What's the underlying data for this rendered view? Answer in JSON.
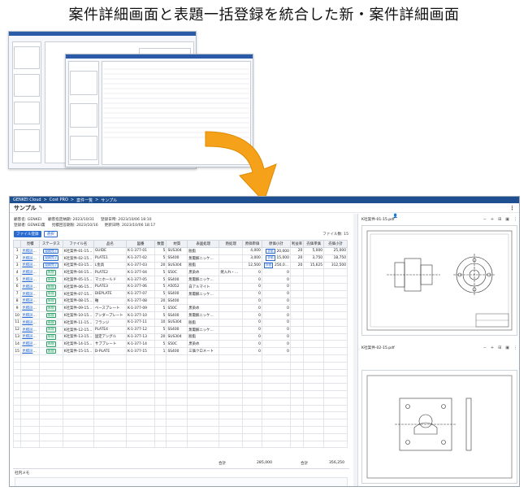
{
  "headline": "案件詳細画面と表題一括登録を統合した新・案件詳細画面",
  "app": {
    "breadcrumb": [
      "GENKEI Cloud",
      ">",
      "Cost PRO",
      ">",
      "案件一覧",
      ">",
      "サンプル"
    ],
    "top_right": [
      "登録",
      "一覧",
      "⚙",
      "▾",
      "👤"
    ],
    "page_title": "サンプル",
    "page_title_icon": "pencil-icon",
    "meta": {
      "client_label": "顧客名: GENKEI",
      "client_deadline": "顧客指定納期: 2023/10/31",
      "registered_at": "登録日時: 2023/10/06 18:10",
      "registrant": "登録者: GENKEI薫",
      "reply_deadline": "見積回答期限: 2023/10/16",
      "updated_at": "更新日時: 2023/10/06 18:17"
    },
    "buttons": {
      "file_register": "ファイル登録",
      "select": "選択"
    },
    "file_count": "ファイル数: 15",
    "columns": [
      "",
      "見積",
      "ステータス",
      "ファイル名",
      "品名",
      "図番",
      "数量",
      "材質",
      "表面処理",
      "熱処理",
      "原価単価",
      "原価小計",
      "利益率",
      "売価単価",
      "売価小計"
    ],
    "rows": [
      {
        "no": "1",
        "link": "見積詳細へ",
        "status": "見積完了",
        "status_type": "done",
        "file": "K社案件-01-15...",
        "name": "GUIDE",
        "drawing": "K-1-377-01",
        "qty": "5",
        "material": "SUS304",
        "surface": "脱脂",
        "heat": "",
        "cost_unit": "4,000",
        "cost_total": "20,000",
        "margin": "20",
        "price_unit": "5,000",
        "price_total": "25,000"
      },
      {
        "no": "2",
        "link": "見積詳細へ",
        "status": "見積完了",
        "status_type": "done",
        "file": "K社案件-02-15...",
        "name": "PLATE1",
        "drawing": "K-1-377-02",
        "qty": "5",
        "material": "SS400",
        "surface": "無電解ニッケ...",
        "heat": "",
        "cost_unit": "3,000",
        "cost_total": "15,000",
        "margin": "20",
        "price_unit": "3,750",
        "price_total": "18,750"
      },
      {
        "no": "3",
        "link": "見積詳細へ",
        "status": "見積完了",
        "status_type": "done",
        "file": "K社案件-03-15...",
        "name": "L金具",
        "drawing": "K-1-377-03",
        "qty": "20",
        "material": "SUS304",
        "surface": "脱脂",
        "heat": "",
        "cost_unit": "12,500",
        "cost_total": "250,000",
        "margin": "20",
        "price_unit": "15,625",
        "price_total": "312,500"
      },
      {
        "no": "4",
        "link": "見積詳細へ",
        "status": "新規",
        "status_type": "new",
        "file": "K社案件-04-15...",
        "name": "PLATE2",
        "drawing": "K-1-377-04",
        "qty": "5",
        "material": "S50C",
        "surface": "黒染め",
        "heat": "焼入れ・焼戻し",
        "cost_unit": "0",
        "cost_total": "0",
        "margin": "",
        "price_unit": "",
        "price_total": ""
      },
      {
        "no": "5",
        "link": "見積詳細へ",
        "status": "新規",
        "status_type": "new",
        "file": "K社案件-05-15...",
        "name": "マニホールド",
        "drawing": "K-1-377-05",
        "qty": "5",
        "material": "SS400",
        "surface": "無電解ニッケ...",
        "heat": "",
        "cost_unit": "0",
        "cost_total": "0",
        "margin": "",
        "price_unit": "",
        "price_total": ""
      },
      {
        "no": "6",
        "link": "見積詳細へ",
        "status": "新規",
        "status_type": "new",
        "file": "K社案件-06-15...",
        "name": "PLATE3",
        "drawing": "K-1-377-06",
        "qty": "5",
        "material": "A5052",
        "surface": "白アルマイト",
        "heat": "",
        "cost_unit": "0",
        "cost_total": "0",
        "margin": "",
        "price_unit": "",
        "price_total": ""
      },
      {
        "no": "7",
        "link": "見積詳細へ",
        "status": "新規",
        "status_type": "new",
        "file": "K社案件-07-15...",
        "name": "DIEPLATE",
        "drawing": "K-1-377-07",
        "qty": "5",
        "material": "SS400",
        "surface": "無電解ニッケ...",
        "heat": "",
        "cost_unit": "0",
        "cost_total": "0",
        "margin": "",
        "price_unit": "",
        "price_total": ""
      },
      {
        "no": "8",
        "link": "見積詳細へ",
        "status": "新規",
        "status_type": "new",
        "file": "K社案件-08-15...",
        "name": "軸",
        "drawing": "K-1-377-08",
        "qty": "20",
        "material": "SS400",
        "surface": "",
        "heat": "",
        "cost_unit": "0",
        "cost_total": "0",
        "margin": "",
        "price_unit": "",
        "price_total": ""
      },
      {
        "no": "9",
        "link": "見積詳細へ",
        "status": "新規",
        "status_type": "new",
        "file": "K社案件-09-15...",
        "name": "ベースプレート",
        "drawing": "K-1-377-09",
        "qty": "5",
        "material": "S50C",
        "surface": "黒染め",
        "heat": "",
        "cost_unit": "0",
        "cost_total": "0",
        "margin": "",
        "price_unit": "",
        "price_total": ""
      },
      {
        "no": "10",
        "link": "見積詳細へ",
        "status": "新規",
        "status_type": "new",
        "file": "K社案件-10-15...",
        "name": "アンダープレート",
        "drawing": "K-1-377-10",
        "qty": "5",
        "material": "SS400",
        "surface": "無電解ニッケ...",
        "heat": "",
        "cost_unit": "0",
        "cost_total": "0",
        "margin": "",
        "price_unit": "",
        "price_total": ""
      },
      {
        "no": "11",
        "link": "見積詳細へ",
        "status": "新規",
        "status_type": "new",
        "file": "K社案件-11-15...",
        "name": "フランジ",
        "drawing": "K-1-377-11",
        "qty": "10",
        "material": "SUS304",
        "surface": "脱脂",
        "heat": "",
        "cost_unit": "0",
        "cost_total": "0",
        "margin": "",
        "price_unit": "",
        "price_total": ""
      },
      {
        "no": "12",
        "link": "見積詳細へ",
        "status": "新規",
        "status_type": "new",
        "file": "K社案件-12-15...",
        "name": "PLATE4",
        "drawing": "K-1-377-12",
        "qty": "5",
        "material": "SS400",
        "surface": "無電解ニッケ...",
        "heat": "",
        "cost_unit": "0",
        "cost_total": "0",
        "margin": "",
        "price_unit": "",
        "price_total": ""
      },
      {
        "no": "13",
        "link": "見積詳細へ",
        "status": "新規",
        "status_type": "new",
        "file": "K社案件-13-15...",
        "name": "固定アングル",
        "drawing": "K-1-377-13",
        "qty": "20",
        "material": "SUS304",
        "surface": "脱脂",
        "heat": "",
        "cost_unit": "0",
        "cost_total": "0",
        "margin": "",
        "price_unit": "",
        "price_total": ""
      },
      {
        "no": "14",
        "link": "見積詳細へ",
        "status": "新規",
        "status_type": "new",
        "file": "K社案件-14-15...",
        "name": "サブプレート",
        "drawing": "K-1-377-14",
        "qty": "5",
        "material": "S50C",
        "surface": "黒染め",
        "heat": "",
        "cost_unit": "0",
        "cost_total": "0",
        "margin": "",
        "price_unit": "",
        "price_total": ""
      },
      {
        "no": "15",
        "link": "見積詳細へ",
        "status": "新規",
        "status_type": "new",
        "file": "K社案件-15-15...",
        "name": "D-PLATE",
        "drawing": "K-1-377-15",
        "qty": "1",
        "material": "SS400",
        "surface": "三価クロメート",
        "heat": "",
        "cost_unit": "0",
        "cost_total": "0",
        "margin": "",
        "price_unit": "",
        "price_total": ""
      }
    ],
    "ext_label": "評価",
    "totals": {
      "label1": "合計",
      "value1": "285,000",
      "label2": "合計",
      "value2": "356,250"
    },
    "memo_label": "社内メモ",
    "pdf1": {
      "filename": "K社案件-01-15.pdf",
      "tools": [
        "−",
        "+",
        "⊞",
        "▣",
        "⋮"
      ]
    },
    "pdf2": {
      "filename": "K社案件-02-15.pdf",
      "tools": [
        "−",
        "+",
        "⊞",
        "▣",
        "⋮"
      ]
    }
  },
  "colors": {
    "brand": "#1d4f91",
    "accent": "#2a6bd1",
    "arrow": "#f5a21a",
    "new_badge": "#2aa36a"
  }
}
